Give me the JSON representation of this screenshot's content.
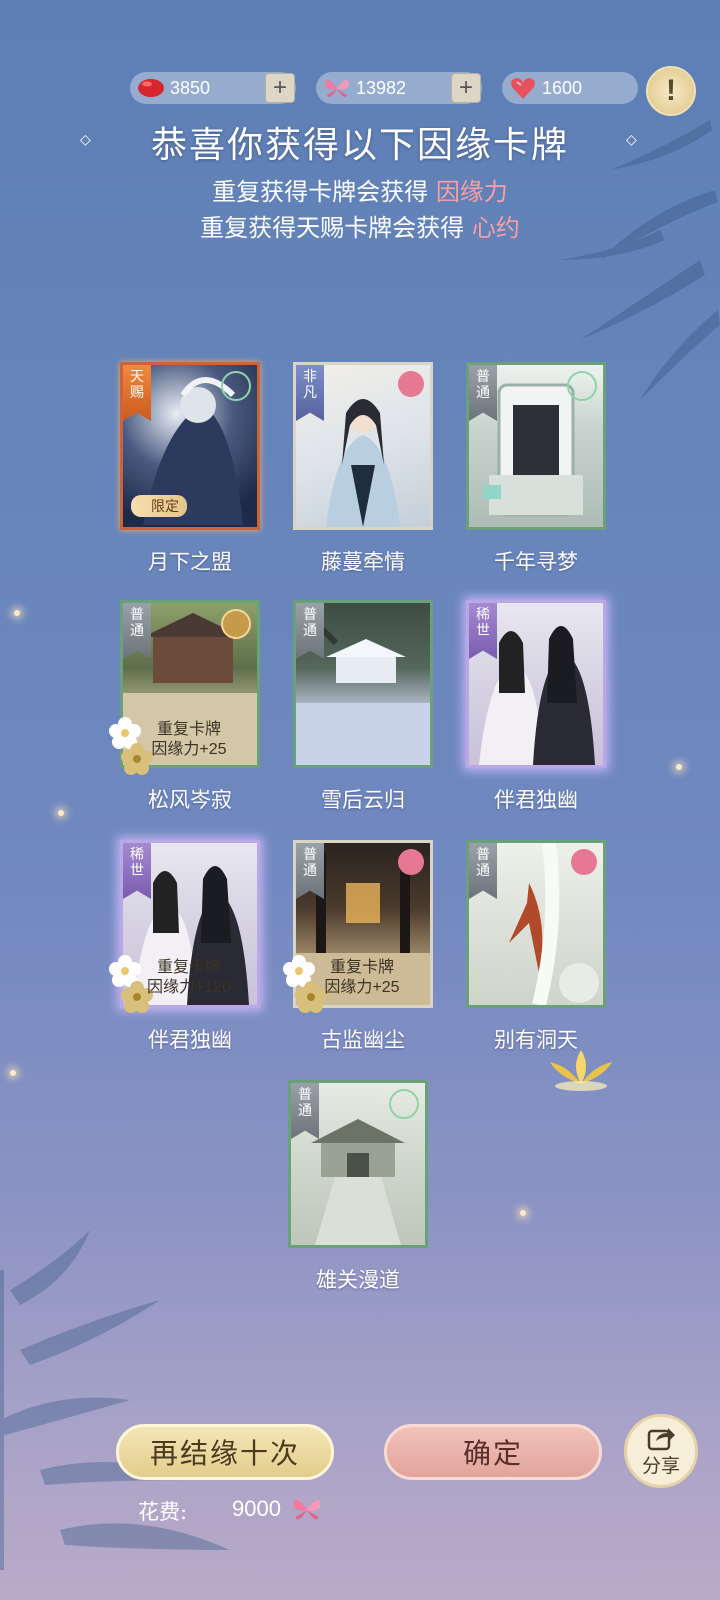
{
  "currencies": [
    {
      "icon": "red-bean-icon",
      "value": "3850",
      "has_plus": true
    },
    {
      "icon": "butterfly-icon",
      "value": "13982",
      "has_plus": true
    },
    {
      "icon": "heart-gem-icon",
      "value": "1600",
      "has_plus": false
    }
  ],
  "help_symbol": "!",
  "title": "恭喜你获得以下因缘卡牌",
  "subtitle1": {
    "text": "重复获得卡牌会获得",
    "highlight": "因缘力"
  },
  "subtitle2": {
    "text": "重复获得天赐卡牌会获得",
    "highlight": "心约"
  },
  "cards": [
    {
      "name": "月下之盟",
      "rarity": "天赐",
      "limited": "限定"
    },
    {
      "name": "藤蔓牵情",
      "rarity": "非凡"
    },
    {
      "name": "千年寻梦",
      "rarity": "普通"
    },
    {
      "name": "松风岑寂",
      "rarity": "普通",
      "dup_line1": "重复卡牌",
      "dup_line2": "因缘力+25"
    },
    {
      "name": "雪后云归",
      "rarity": "普通"
    },
    {
      "name": "伴君独幽",
      "rarity": "稀世"
    },
    {
      "name": "伴君独幽",
      "rarity": "稀世",
      "dup_line1": "重复卡牌",
      "dup_line2": "因缘力+120"
    },
    {
      "name": "古监幽尘",
      "rarity": "普通",
      "dup_line1": "重复卡牌",
      "dup_line2": "因缘力+25"
    },
    {
      "name": "别有洞天",
      "rarity": "普通"
    },
    {
      "name": "雄关漫道",
      "rarity": "普通"
    }
  ],
  "buttons": {
    "again": "再结缘十次",
    "confirm": "确定",
    "share": "分享"
  },
  "cost": {
    "label": "花费:",
    "value": "9000"
  },
  "colors": {
    "highlight": "#f6a0a6",
    "gold_button": "#e3cd8c",
    "pink_button": "#e2a49c"
  }
}
